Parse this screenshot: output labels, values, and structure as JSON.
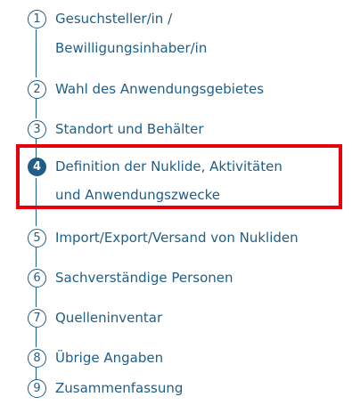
{
  "steps": [
    {
      "number": "1",
      "label_line1": "Gesuchsteller/in /",
      "label_line2": "Bewilligungsinhaber/in",
      "active": false
    },
    {
      "number": "2",
      "label_line1": "Wahl des Anwendungsgebietes",
      "active": false
    },
    {
      "number": "3",
      "label_line1": "Standort und Behälter",
      "active": false
    },
    {
      "number": "4",
      "label_line1": "Definition der Nuklide, Aktivitäten",
      "label_line2": "und Anwendungszwecke",
      "active": true
    },
    {
      "number": "5",
      "label_line1": "Import/Export/Versand von Nukliden",
      "active": false
    },
    {
      "number": "6",
      "label_line1": "Sachverständige Personen",
      "active": false
    },
    {
      "number": "7",
      "label_line1": "Quelleninventar",
      "active": false
    },
    {
      "number": "8",
      "label_line1": "Übrige Angaben",
      "active": false
    },
    {
      "number": "9",
      "label_line1": "Zusammenfassung",
      "active": false
    }
  ],
  "colors": {
    "accent": "#1f5e87",
    "highlight": "#e8000d"
  }
}
